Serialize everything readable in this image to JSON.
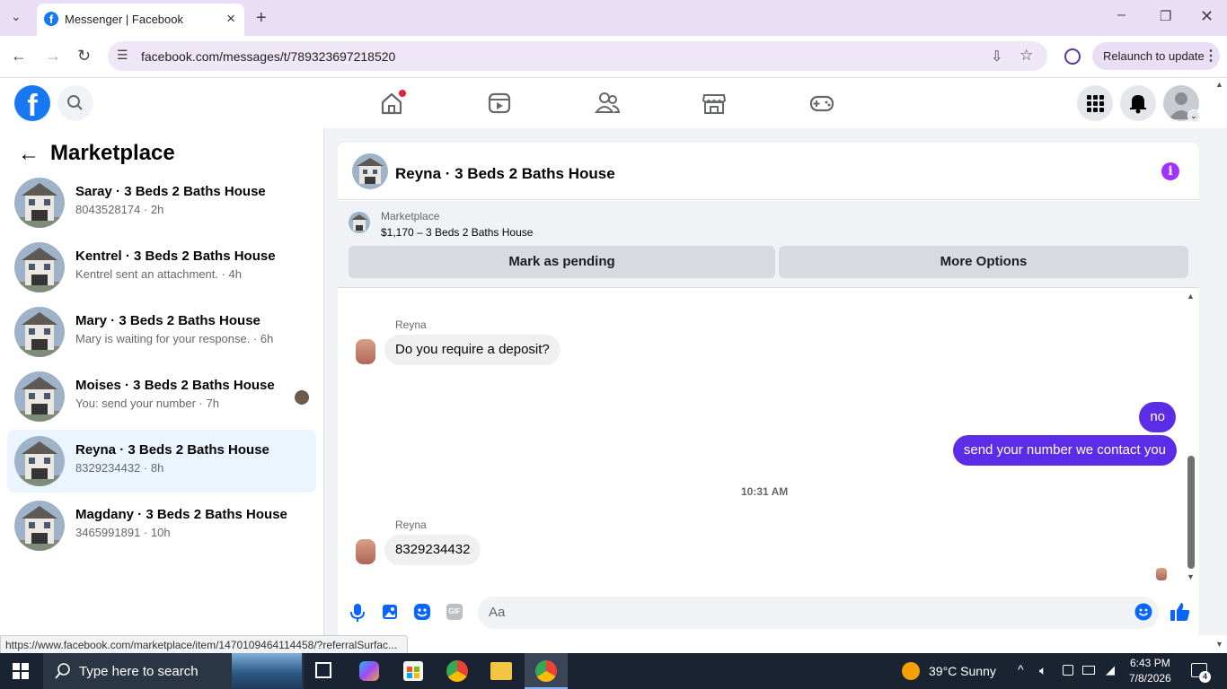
{
  "browser": {
    "tab_title": "Messenger | Facebook",
    "url": "facebook.com/messages/t/789323697218520",
    "relaunch_label": "Relaunch to update"
  },
  "facebook": {
    "logo": "f",
    "nav_icons": [
      "home-icon",
      "video-icon",
      "friends-icon",
      "marketplace-icon",
      "gaming-icon"
    ],
    "right_icons": [
      "menu-grid-icon",
      "bell-icon",
      "account-avatar"
    ]
  },
  "sidebar": {
    "title": "Marketplace",
    "conversations": [
      {
        "name": "Saray · 3 Beds 2 Baths House",
        "preview": "8043528174 · 2h"
      },
      {
        "name": "Kentrel · 3 Beds 2 Baths House",
        "preview": "Kentrel sent an attachment. · 4h"
      },
      {
        "name": "Mary · 3 Beds 2 Baths House",
        "preview": "Mary is waiting for your response. · 6h"
      },
      {
        "name": "Moises · 3 Beds 2 Baths House",
        "preview": "You: send your number · 7h"
      },
      {
        "name": "Reyna · 3 Beds 2 Baths House",
        "preview": "8329234432 · 8h"
      },
      {
        "name": "Magdany · 3 Beds 2 Baths House",
        "preview": "3465991891 · 10h"
      }
    ]
  },
  "chat": {
    "title": "Reyna · 3 Beds 2 Baths House",
    "info_icon": "i",
    "listing_label": "Marketplace",
    "listing_price": "$1,170 – 3 Beds 2 Baths House",
    "mark_pending": "Mark as pending",
    "more_options": "More Options",
    "messages": [
      {
        "sender": "Reyna",
        "text": "Do you require a deposit?"
      },
      {
        "sender": "me",
        "text": "no"
      },
      {
        "sender": "me",
        "text": "send your number we contact you"
      },
      {
        "sender": "Reyna",
        "text": "8329234432"
      }
    ],
    "timestamp": "10:31 AM",
    "placeholder": "Aa",
    "gif_label": "GIF"
  },
  "status_url": "https://www.facebook.com/marketplace/item/1470109464114458/?referralSurfac...",
  "taskbar": {
    "search_placeholder": "Type here to search",
    "weather": "39°C  Sunny",
    "time": "6:43 PM",
    "date": "7/8/2026",
    "notifications": "4"
  }
}
